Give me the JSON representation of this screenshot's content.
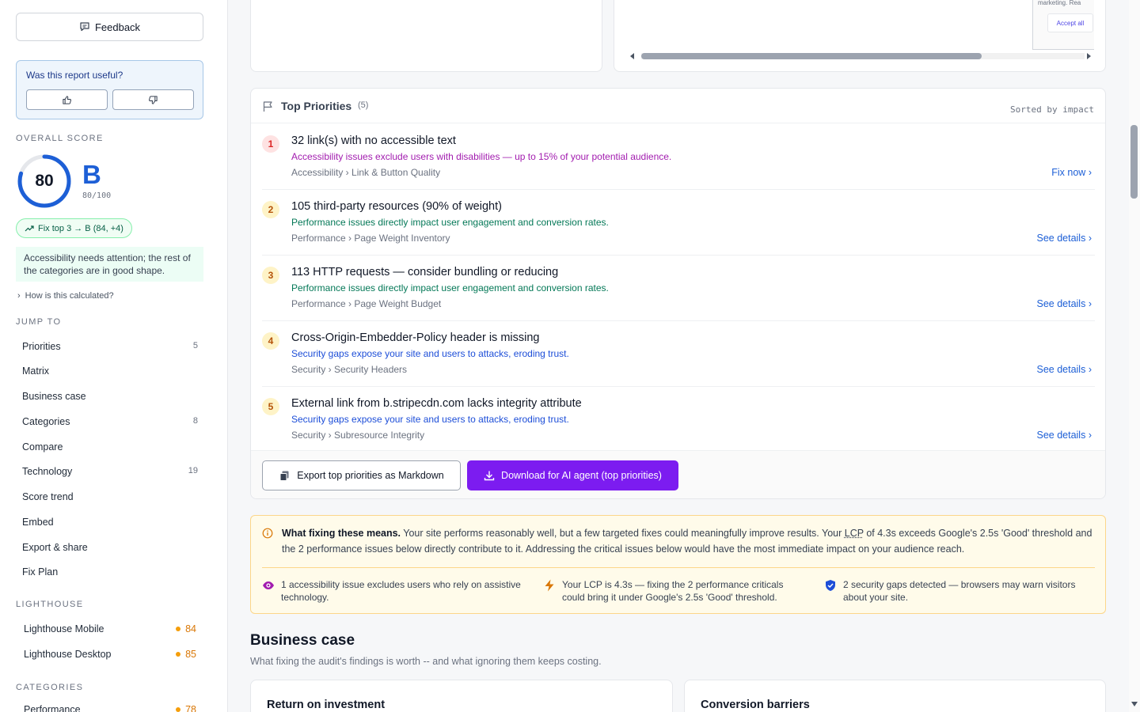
{
  "sidebar": {
    "feedback_label": "Feedback",
    "useful_question": "Was this report useful?",
    "overall_label": "OVERALL SCORE",
    "score": "80",
    "score_progress": 0.8,
    "grade": "B",
    "grade_sub": "80/100",
    "fix_top": "Fix top 3 → B (84, +4)",
    "note": "Accessibility needs attention; the rest of the categories are in good shape.",
    "how_calc": "How is this calculated?",
    "jump_label": "JUMP TO",
    "nav": [
      {
        "label": "Priorities",
        "count": "5"
      },
      {
        "label": "Matrix",
        "count": ""
      },
      {
        "label": "Business case",
        "count": ""
      },
      {
        "label": "Categories",
        "count": "8"
      },
      {
        "label": "Compare",
        "count": ""
      },
      {
        "label": "Technology",
        "count": "19"
      },
      {
        "label": "Score trend",
        "count": ""
      },
      {
        "label": "Embed",
        "count": ""
      },
      {
        "label": "Export & share",
        "count": ""
      },
      {
        "label": "Fix Plan",
        "count": ""
      }
    ],
    "lighthouse_label": "LIGHTHOUSE",
    "lighthouse": [
      {
        "label": "Lighthouse Mobile",
        "score": "84"
      },
      {
        "label": "Lighthouse Desktop",
        "score": "85"
      }
    ],
    "categories_label": "CATEGORIES",
    "categories": [
      {
        "label": "Performance",
        "score": "78"
      }
    ]
  },
  "preview": {
    "marketing_text": "marketing. Rea",
    "accept_label": "Accept all"
  },
  "priorities": {
    "title": "Top Priorities",
    "count": "(5)",
    "sorted": "Sorted by impact",
    "items": [
      {
        "num": "1",
        "title": "32 link(s) with no accessible text",
        "desc": "Accessibility issues exclude users with disabilities — up to 15% of your potential audience.",
        "crumb": "Accessibility › Link & Button Quality",
        "action": "Fix now"
      },
      {
        "num": "2",
        "title": "105 third-party resources (90% of weight)",
        "desc": "Performance issues directly impact user engagement and conversion rates.",
        "crumb": "Performance › Page Weight Inventory",
        "action": "See details"
      },
      {
        "num": "3",
        "title": "113 HTTP requests — consider bundling or reducing",
        "desc": "Performance issues directly impact user engagement and conversion rates.",
        "crumb": "Performance › Page Weight Budget",
        "action": "See details"
      },
      {
        "num": "4",
        "title": "Cross-Origin-Embedder-Policy header is missing",
        "desc": "Security gaps expose your site and users to attacks, eroding trust.",
        "crumb": "Security › Security Headers",
        "action": "See details"
      },
      {
        "num": "5",
        "title": "External link from b.stripecdn.com lacks integrity attribute",
        "desc": "Security gaps expose your site and users to attacks, eroding trust.",
        "crumb": "Security › Subresource Integrity",
        "action": "See details"
      }
    ],
    "export_label": "Export top priorities as Markdown",
    "ai_label": "Download for AI agent (top priorities)"
  },
  "fixing": {
    "bold": "What fixing these means.",
    "text_a": " Your site performs reasonably well, but a few targeted fixes could meaningfully improve results. Your ",
    "lcp": "LCP",
    "text_b": " of 4.3s exceeds Google's 2.5s 'Good' threshold and the 2 performance issues below directly contribute to it. Addressing the critical issues below would have the most immediate impact on your audience reach.",
    "impacts": [
      "1 accessibility issue excludes users who rely on assistive technology.",
      "Your LCP is 4.3s — fixing the 2 performance criticals could bring it under Google's 2.5s 'Good' threshold.",
      "2 security gaps detected — browsers may warn visitors about your site."
    ]
  },
  "business": {
    "title": "Business case",
    "subtitle": "What fixing the audit's findings is worth -- and what ignoring them keeps costing.",
    "cards": [
      "Return on investment",
      "Conversion barriers"
    ]
  },
  "colors": {
    "accent": "#1d5fd6",
    "ai_button": "#7c1cf0",
    "desc_accessibility": "#a21caf",
    "desc_performance": "#047857",
    "desc_security": "#1d4ed8"
  }
}
